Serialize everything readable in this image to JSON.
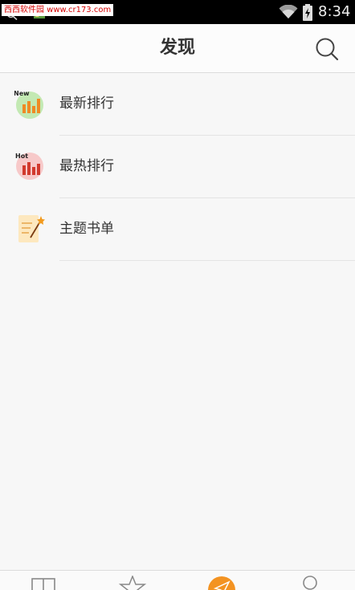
{
  "status_bar": {
    "watermark": "西西软件园 www.cr173.com",
    "time": "8:34",
    "icons": [
      "search-icon",
      "app-icon",
      "wifi-icon",
      "battery-icon"
    ]
  },
  "header": {
    "title": "发现",
    "search_icon": "search-icon"
  },
  "list": {
    "items": [
      {
        "label": "最新排行",
        "icon": "new-ranking-icon",
        "badge": "New"
      },
      {
        "label": "最热排行",
        "icon": "hot-ranking-icon",
        "badge": "Hot"
      },
      {
        "label": "主题书单",
        "icon": "book-list-icon"
      }
    ]
  },
  "bottom_nav": {
    "tabs": [
      {
        "icon": "bookshelf-icon"
      },
      {
        "icon": "star-icon"
      },
      {
        "icon": "discover-icon",
        "active": true
      },
      {
        "icon": "profile-icon"
      }
    ],
    "accent_color": "#f39322"
  },
  "colors": {
    "background": "#f7f7f7",
    "title_bar": "#fcfcfc",
    "text": "#333333",
    "accent": "#f39322"
  }
}
